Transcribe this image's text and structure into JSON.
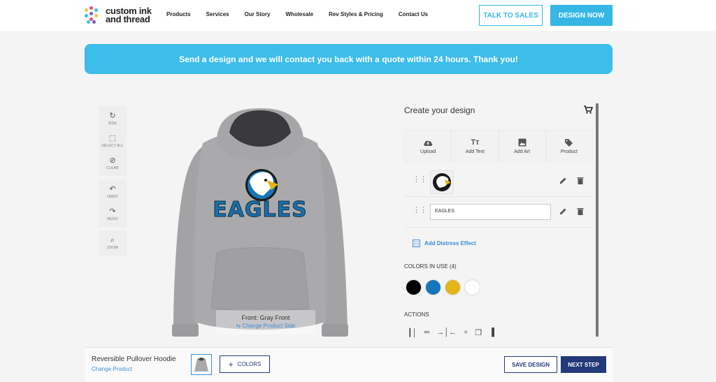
{
  "header": {
    "logo_text_line1": "custom ink",
    "logo_text_line2": "and thread",
    "nav": [
      "Products",
      "Services",
      "Our Story",
      "Wholesale",
      "Rev Styles & Pricing",
      "Contact Us"
    ],
    "talk_to_sales": "TALK TO SALES",
    "design_now": "DESIGN NOW"
  },
  "banner": {
    "text": "Send a design and we will contact you back with a quote within 24 hours. Thank you!"
  },
  "tools": {
    "side": "SIDE",
    "select_all": "SELECT ALL",
    "clear": "CLEAR",
    "undo": "UNDO",
    "redo": "REDO",
    "zoom": "ZOOM"
  },
  "canvas": {
    "design_text": "EAGLES",
    "side_title": "Front: Gray Front",
    "change_side": "Change Product Side",
    "product_color": "#a9a9ab"
  },
  "panel": {
    "title": "Create your design",
    "tabs": [
      {
        "label": "Upload",
        "icon": "cloud-upload-icon"
      },
      {
        "label": "Add Text",
        "icon": "text-icon"
      },
      {
        "label": "Add Art",
        "icon": "image-icon"
      },
      {
        "label": "Product",
        "icon": "tag-icon"
      }
    ],
    "text_layer_value": "EAGLES",
    "distress_effect": "Add Distress Effect",
    "colors_title": "COLORS IN USE (4)",
    "colors": [
      "#000000",
      "#1576b8",
      "#e2b51a",
      "#ffffff"
    ],
    "actions_title": "ACTIONS"
  },
  "footer": {
    "product_name": "Reversible Pullover Hoodie",
    "change_product": "Change Product",
    "colors_button": "COLORS",
    "save_design": "SAVE DESIGN",
    "next_step": "NEXT STEP"
  }
}
